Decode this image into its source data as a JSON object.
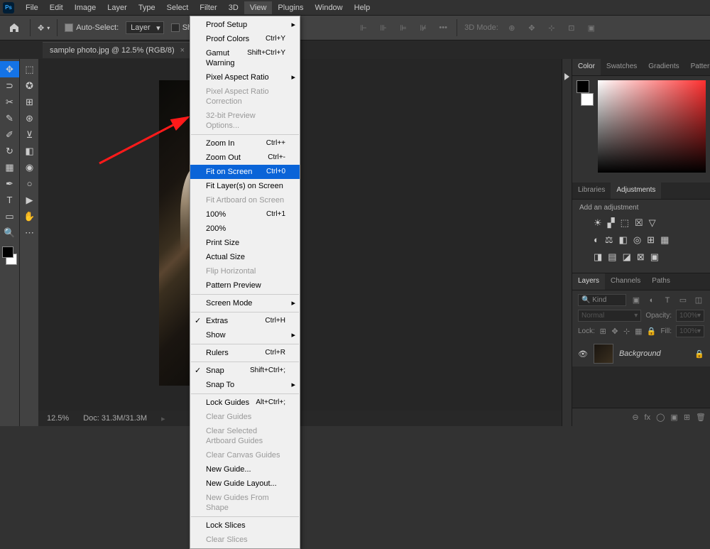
{
  "app": {
    "name": "Ps"
  },
  "menubar": [
    "File",
    "Edit",
    "Image",
    "Layer",
    "Type",
    "Select",
    "Filter",
    "3D",
    "View",
    "Plugins",
    "Window",
    "Help"
  ],
  "optbar": {
    "auto_select": "Auto-Select:",
    "layer": "Layer",
    "show_transform": "Show Tra",
    "mode_label": "3D Mode:"
  },
  "document": {
    "tab_title": "sample photo.jpg @ 12.5% (RGB/8)",
    "zoom": "12.5%",
    "doc_info": "Doc: 31.3M/31.3M"
  },
  "view_menu": [
    {
      "label": "Proof Setup",
      "arrow": true
    },
    {
      "label": "Proof Colors",
      "short": "Ctrl+Y"
    },
    {
      "label": "Gamut Warning",
      "short": "Shift+Ctrl+Y"
    },
    {
      "label": "Pixel Aspect Ratio",
      "arrow": true
    },
    {
      "label": "Pixel Aspect Ratio Correction",
      "disabled": true
    },
    {
      "label": "32-bit Preview Options...",
      "disabled": true
    },
    {
      "sep": true
    },
    {
      "label": "Zoom In",
      "short": "Ctrl++"
    },
    {
      "label": "Zoom Out",
      "short": "Ctrl+-"
    },
    {
      "label": "Fit on Screen",
      "short": "Ctrl+0",
      "highlighted": true
    },
    {
      "label": "Fit Layer(s) on Screen"
    },
    {
      "label": "Fit Artboard on Screen",
      "disabled": true
    },
    {
      "label": "100%",
      "short": "Ctrl+1"
    },
    {
      "label": "200%"
    },
    {
      "label": "Print Size"
    },
    {
      "label": "Actual Size"
    },
    {
      "label": "Flip Horizontal",
      "disabled": true
    },
    {
      "label": "Pattern Preview"
    },
    {
      "sep": true
    },
    {
      "label": "Screen Mode",
      "arrow": true
    },
    {
      "sep": true
    },
    {
      "label": "Extras",
      "short": "Ctrl+H",
      "check": true
    },
    {
      "label": "Show",
      "arrow": true
    },
    {
      "sep": true
    },
    {
      "label": "Rulers",
      "short": "Ctrl+R"
    },
    {
      "sep": true
    },
    {
      "label": "Snap",
      "short": "Shift+Ctrl+;",
      "check": true
    },
    {
      "label": "Snap To",
      "arrow": true
    },
    {
      "sep": true
    },
    {
      "label": "Lock Guides",
      "short": "Alt+Ctrl+;"
    },
    {
      "label": "Clear Guides",
      "disabled": true
    },
    {
      "label": "Clear Selected Artboard Guides",
      "disabled": true
    },
    {
      "label": "Clear Canvas Guides",
      "disabled": true
    },
    {
      "label": "New Guide..."
    },
    {
      "label": "New Guide Layout..."
    },
    {
      "label": "New Guides From Shape",
      "disabled": true
    },
    {
      "sep": true
    },
    {
      "label": "Lock Slices"
    },
    {
      "label": "Clear Slices",
      "disabled": true
    }
  ],
  "panels": {
    "color_tabs": [
      "Color",
      "Swatches",
      "Gradients",
      "Patterns"
    ],
    "adj_tabs": [
      "Libraries",
      "Adjustments"
    ],
    "adj_title": "Add an adjustment",
    "layer_tabs": [
      "Layers",
      "Channels",
      "Paths"
    ],
    "layer_kind": "Kind",
    "blend_mode": "Normal",
    "opacity_label": "Opacity:",
    "opacity_value": "100%",
    "lock_label": "Lock:",
    "fill_label": "Fill:",
    "fill_value": "100%",
    "layer_name": "Background"
  }
}
